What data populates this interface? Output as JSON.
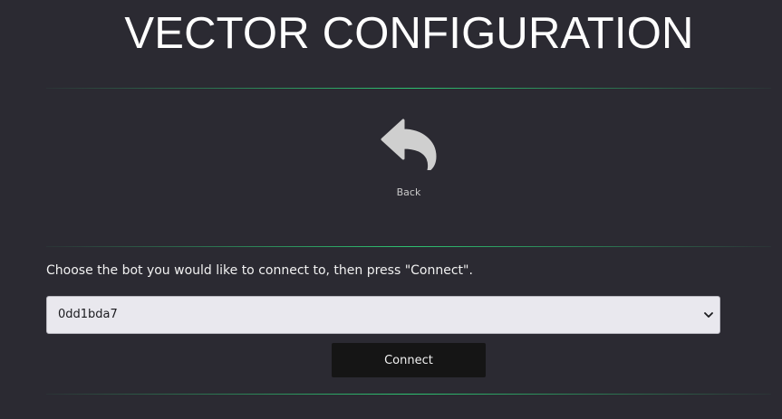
{
  "header": {
    "title": "VECTOR CONFIGURATION"
  },
  "back": {
    "label": "Back",
    "icon": "back-arrow-icon"
  },
  "form": {
    "instruction": "Choose the bot you would like to connect to, then press \"Connect\".",
    "bot_select": {
      "selected": "0dd1bda7",
      "icon": "chevron-down-icon"
    },
    "connect_label": "Connect"
  },
  "colors": {
    "background": "#2b2a32",
    "divider_accent": "#2ed278",
    "button_bg": "#151515",
    "select_bg": "#e9e8ee",
    "icon_gray": "#cfcfcf"
  }
}
